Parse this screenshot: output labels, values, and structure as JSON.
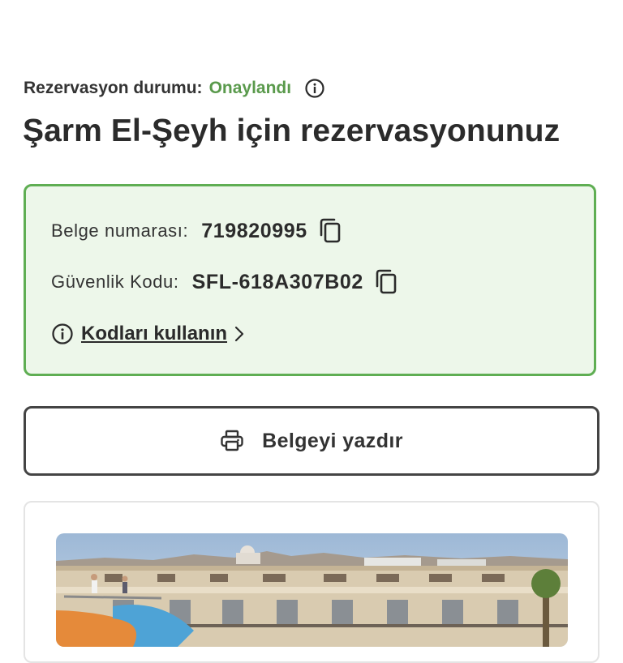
{
  "booking": {
    "status_label": "Rezervasyon durumu:",
    "status_value": "Onaylandı",
    "title": "Şarm El-Şeyh için rezervasyonunuz"
  },
  "codes": {
    "document_label": "Belge numarası:",
    "document_value": "719820995",
    "security_label": "Güvenlik Kodu:",
    "security_value": "SFL-618A307B02",
    "use_codes_link": "Kodları kullanın"
  },
  "actions": {
    "print_label": "Belgeyi yazdır"
  },
  "icons": {
    "status_info": "info-icon",
    "copy": "copy-icon",
    "link_info": "info-icon",
    "link_chevron": "chevron-right-icon",
    "print": "printer-icon"
  },
  "colors": {
    "confirmed": "#5a9a4c",
    "card_border": "#5fae53",
    "card_background": "#edf7ea",
    "text": "#2b2b2b"
  }
}
